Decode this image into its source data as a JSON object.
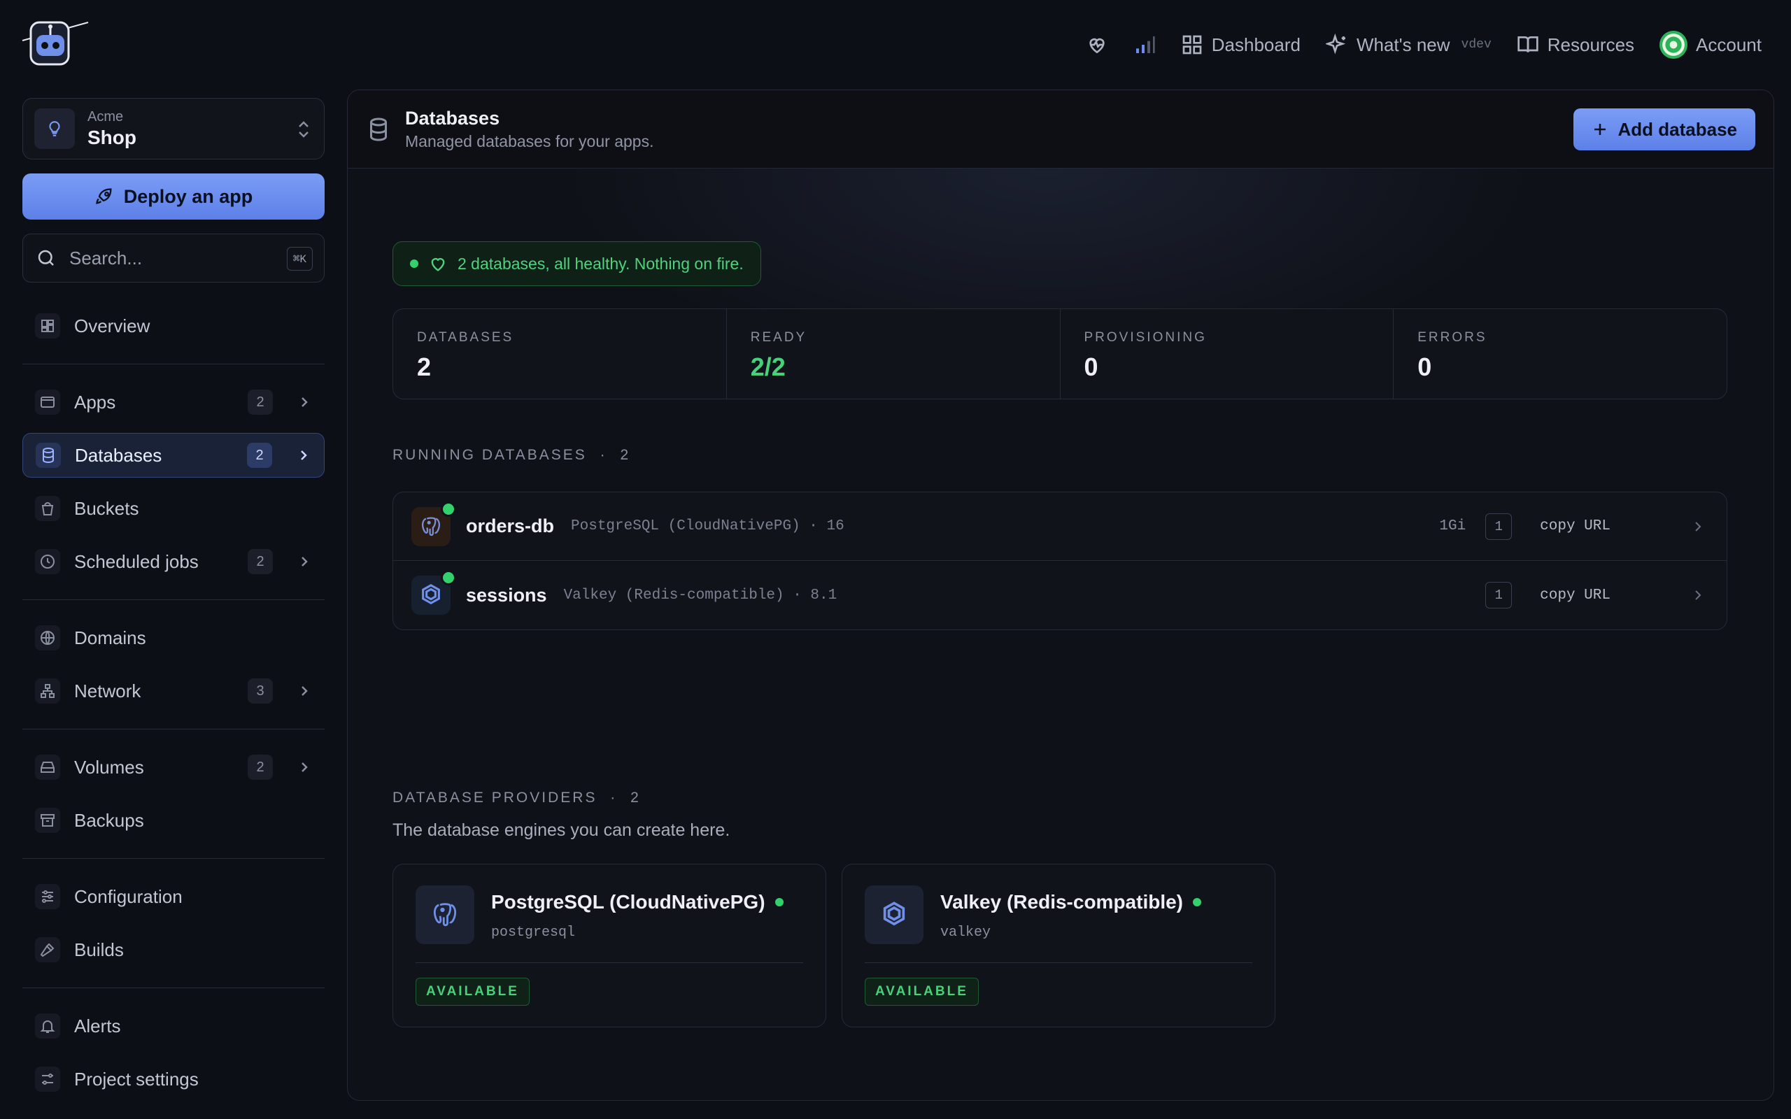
{
  "topnav": {
    "dashboard": "Dashboard",
    "whats_new": "What's new",
    "version": "vdev",
    "resources": "Resources",
    "account": "Account"
  },
  "project": {
    "org": "Acme",
    "name": "Shop"
  },
  "sidebar": {
    "deploy_label": "Deploy an app",
    "search_placeholder": "Search...",
    "search_shortcut": "⌘K",
    "items": [
      {
        "label": "Overview"
      },
      {
        "label": "Apps",
        "count": "2"
      },
      {
        "label": "Databases",
        "count": "2"
      },
      {
        "label": "Buckets"
      },
      {
        "label": "Scheduled jobs",
        "count": "2"
      },
      {
        "label": "Domains"
      },
      {
        "label": "Network",
        "count": "3"
      },
      {
        "label": "Volumes",
        "count": "2"
      },
      {
        "label": "Backups"
      },
      {
        "label": "Configuration"
      },
      {
        "label": "Builds"
      },
      {
        "label": "Alerts"
      },
      {
        "label": "Project settings"
      }
    ]
  },
  "main": {
    "title": "Databases",
    "subtitle": "Managed databases for your apps.",
    "add_label": "Add database",
    "health": "2 databases, all healthy. Nothing on fire.",
    "stats": [
      {
        "label": "DATABASES",
        "value": "2"
      },
      {
        "label": "READY",
        "value": "2/2"
      },
      {
        "label": "PROVISIONING",
        "value": "0"
      },
      {
        "label": "ERRORS",
        "value": "0"
      }
    ],
    "running_title": "RUNNING DATABASES",
    "running_count": "2",
    "databases": [
      {
        "name": "orders-db",
        "meta": "PostgreSQL (CloudNativePG) · 16",
        "size": "1Gi",
        "replicas": "1",
        "copy": "copy URL"
      },
      {
        "name": "sessions",
        "meta": "Valkey (Redis-compatible) · 8.1",
        "replicas": "1",
        "copy": "copy URL"
      }
    ],
    "providers_title": "DATABASE PROVIDERS",
    "providers_count": "2",
    "providers_sub": "The database engines you can create here.",
    "providers": [
      {
        "name": "PostgreSQL (CloudNativePG)",
        "slug": "postgresql",
        "status": "AVAILABLE"
      },
      {
        "name": "Valkey (Redis-compatible)",
        "slug": "valkey",
        "status": "AVAILABLE"
      }
    ]
  },
  "colors": {
    "accent": "#6b8cf0",
    "success": "#33d16b",
    "background": "#0d0f17"
  }
}
